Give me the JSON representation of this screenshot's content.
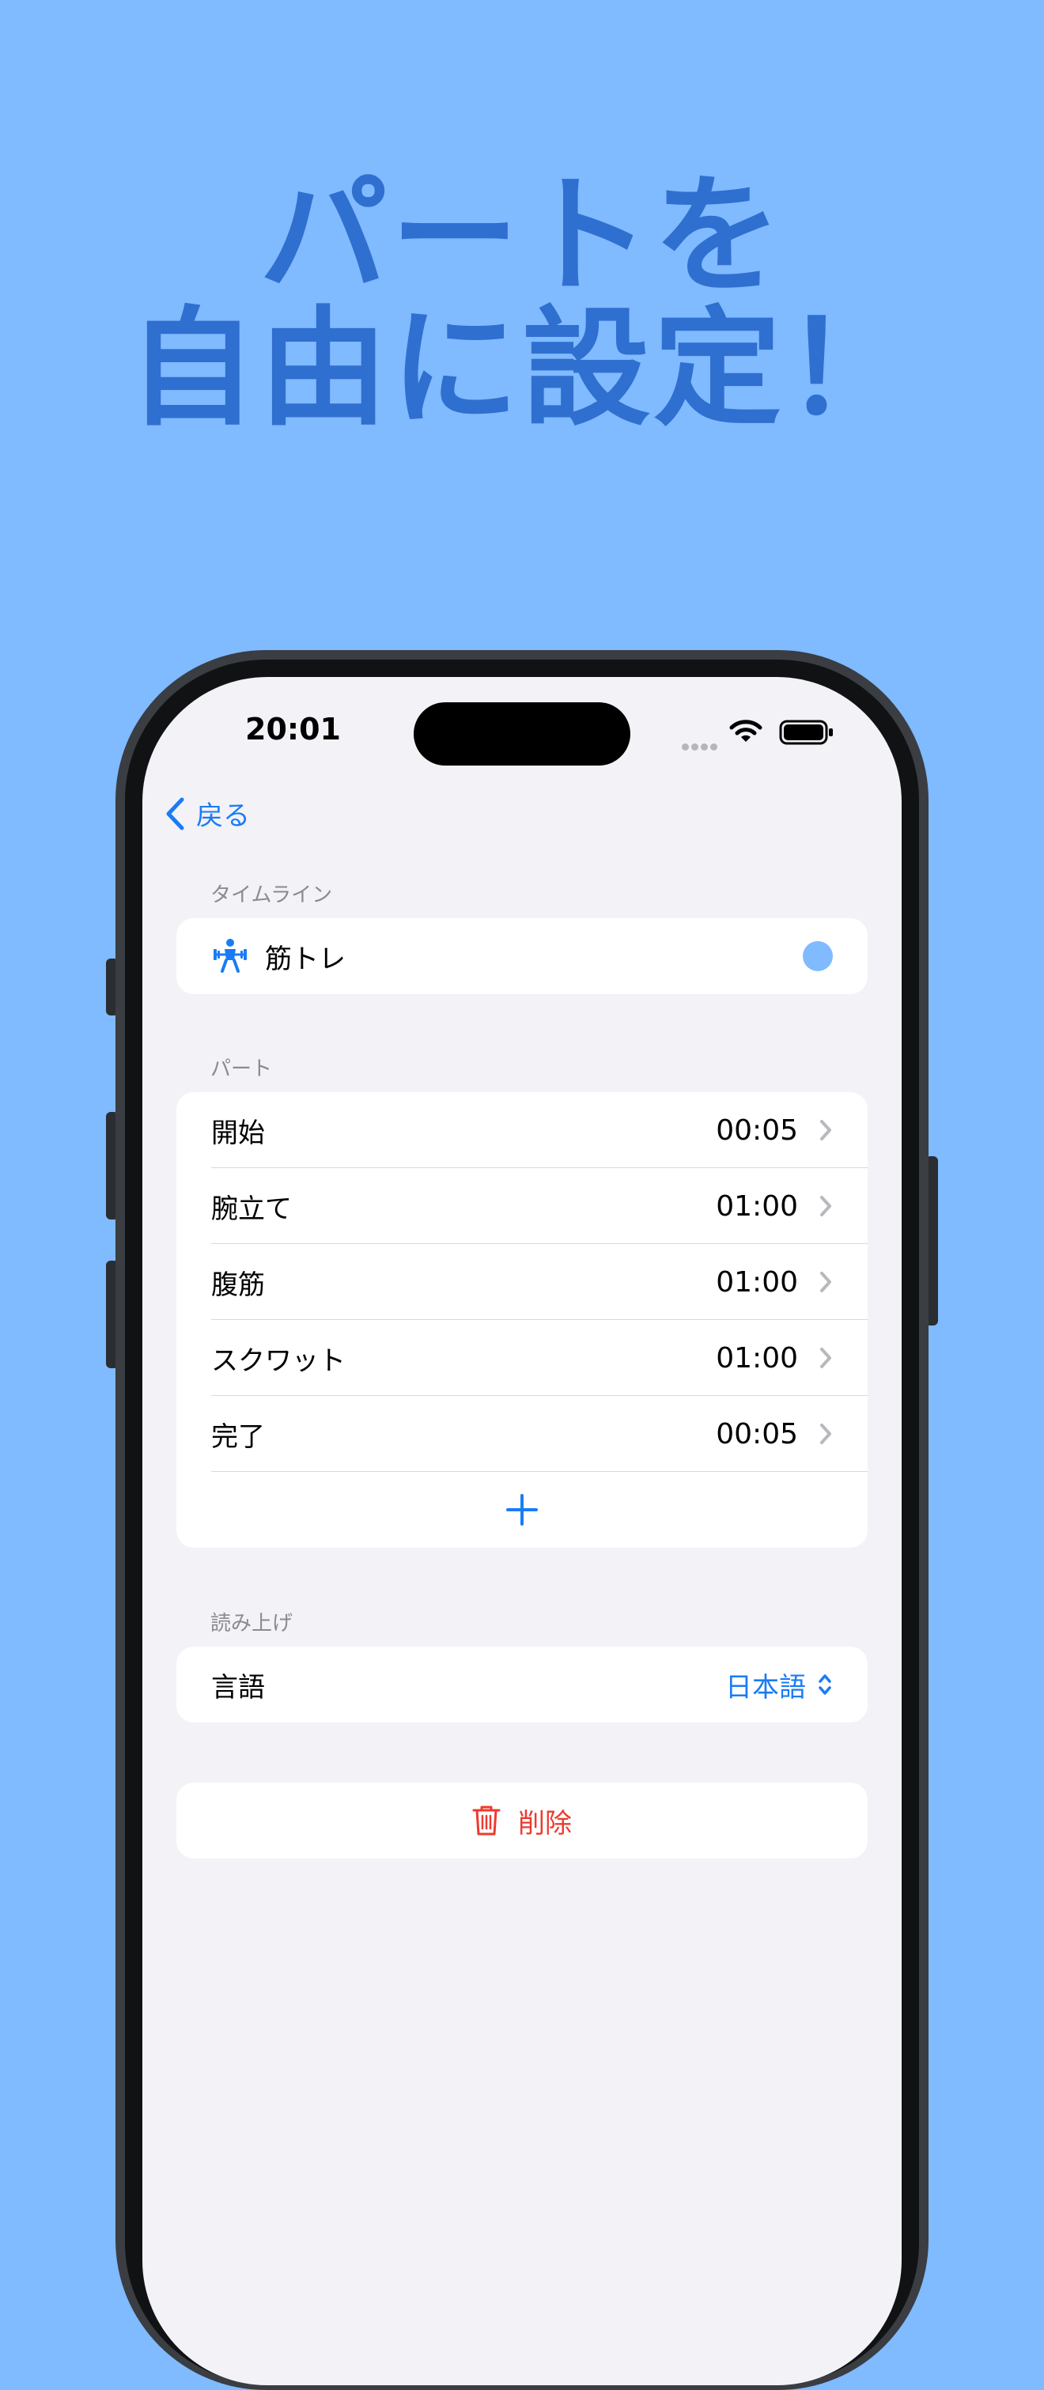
{
  "headline": {
    "line1": "パートを",
    "line2": "自由に設定！"
  },
  "status_bar": {
    "time": "20:01"
  },
  "nav": {
    "back_label": "戻る"
  },
  "timeline_section": {
    "header": "タイムライン",
    "item": {
      "icon": "weightlifting-icon",
      "label": "筋トレ",
      "color": "#80baff"
    }
  },
  "parts_section": {
    "header": "パート",
    "items": [
      {
        "label": "開始",
        "duration": "00:05"
      },
      {
        "label": "腕立て",
        "duration": "01:00"
      },
      {
        "label": "腹筋",
        "duration": "01:00"
      },
      {
        "label": "スクワット",
        "duration": "01:00"
      },
      {
        "label": "完了",
        "duration": "00:05"
      }
    ]
  },
  "speech_section": {
    "header": "読み上げ",
    "language_label": "言語",
    "language_value": "日本語"
  },
  "delete": {
    "label": "削除"
  },
  "colors": {
    "accent": "#1a7cf5",
    "destructive": "#ee3a2f",
    "background": "#80baff",
    "headline": "#2f6fd0"
  }
}
